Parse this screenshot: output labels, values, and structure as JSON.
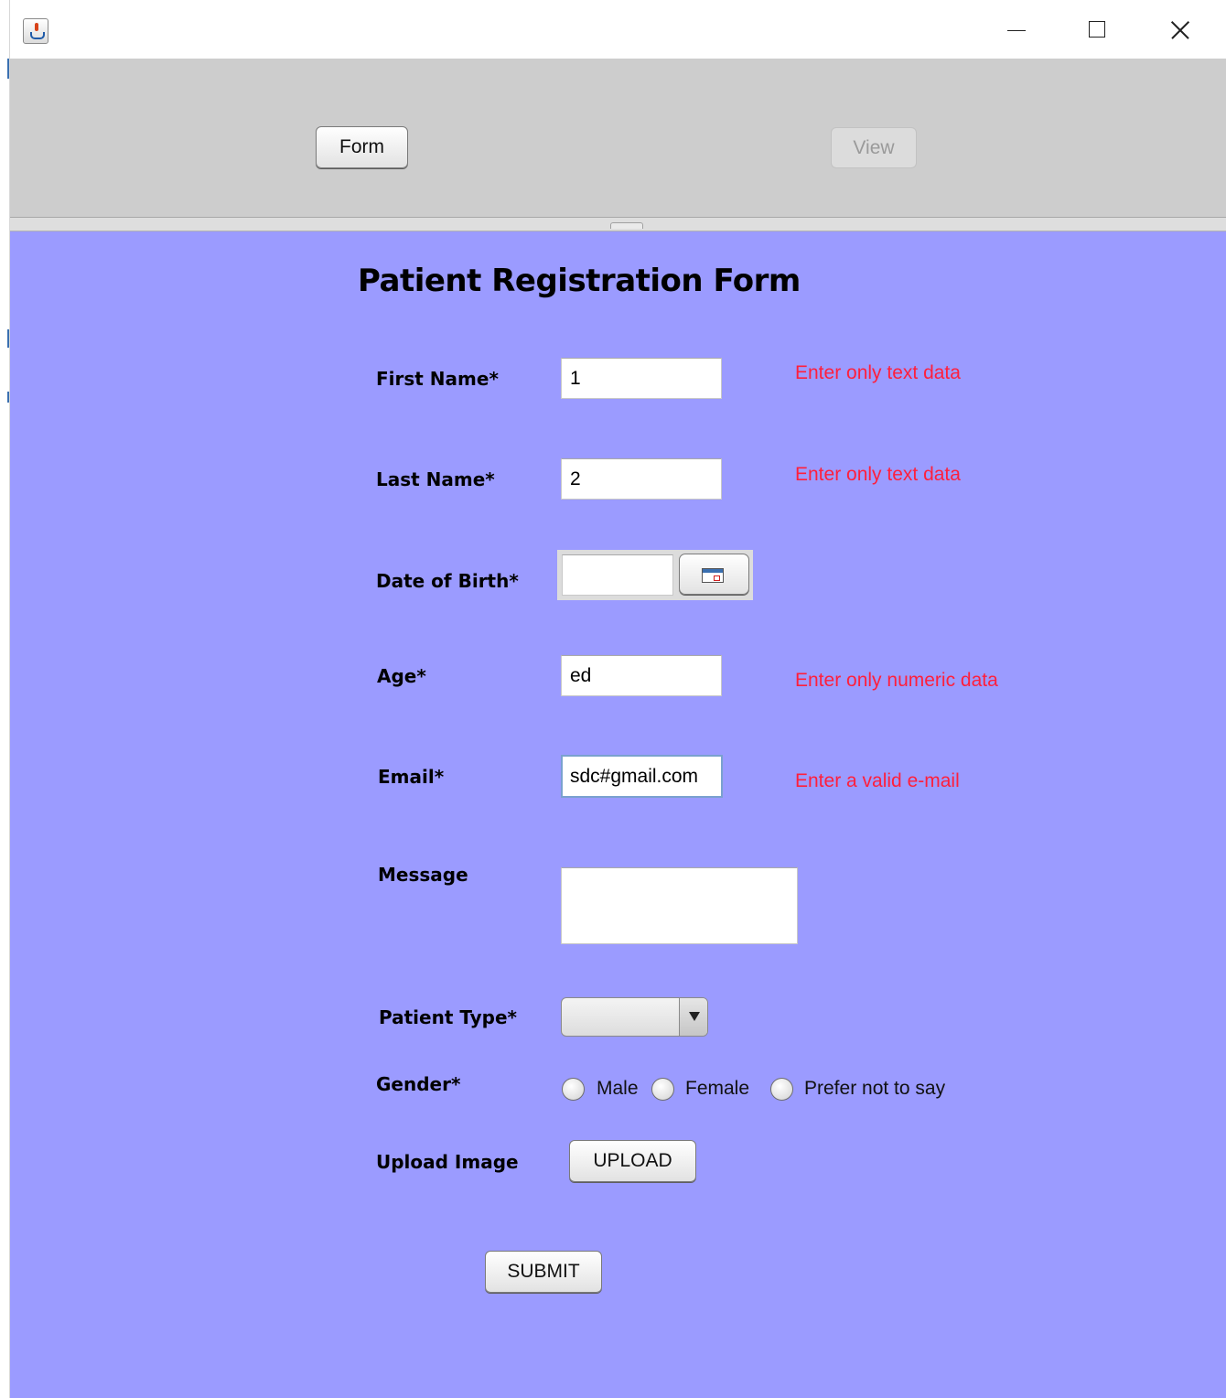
{
  "window": {
    "app_icon": "java-cup-icon",
    "minimize_icon": "minimize-icon",
    "maximize_icon": "maximize-icon",
    "close_icon": "close-icon"
  },
  "nav": {
    "form_label": "Form",
    "view_label": "View"
  },
  "form": {
    "title": "Patient Registration Form",
    "first_name": {
      "label": "First Name*",
      "value": "1",
      "error": "Enter only text data"
    },
    "last_name": {
      "label": "Last Name*",
      "value": "2",
      "error": "Enter only text data"
    },
    "dob": {
      "label": "Date of Birth*",
      "value": "",
      "button_icon": "calendar-icon"
    },
    "age": {
      "label": "Age*",
      "value": "ed",
      "error": "Enter only numeric data"
    },
    "email": {
      "label": "Email*",
      "value": "sdc#gmail.com",
      "error": "Enter a valid e-mail"
    },
    "message": {
      "label": "Message",
      "value": ""
    },
    "patient_type": {
      "label": "Patient Type*",
      "selected": ""
    },
    "gender": {
      "label": "Gender*",
      "options": [
        "Male",
        "Female",
        "Prefer not to say"
      ]
    },
    "upload": {
      "label": "Upload Image",
      "button": "UPLOAD"
    },
    "submit": "SUBMIT"
  },
  "colors": {
    "form_background": "#9b9bff",
    "top_panel": "#cdcdcd",
    "error_text": "#ff1f3c"
  }
}
